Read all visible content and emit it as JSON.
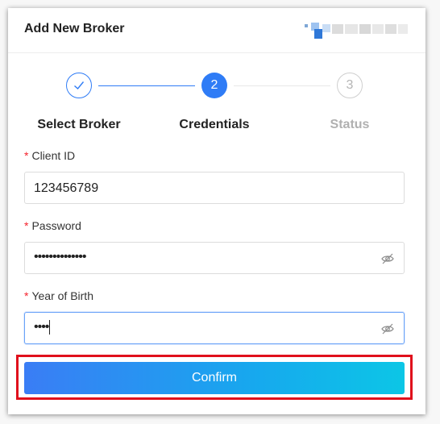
{
  "dialog": {
    "title": "Add New Broker"
  },
  "steps": [
    {
      "number": "1",
      "label": "Select Broker",
      "state": "done"
    },
    {
      "number": "2",
      "label": "Credentials",
      "state": "active"
    },
    {
      "number": "3",
      "label": "Status",
      "state": "pending"
    }
  ],
  "form": {
    "required_mark": "*",
    "client_id": {
      "label": "Client ID",
      "value": "123456789"
    },
    "password": {
      "label": "Password",
      "value": "••••••••••••••"
    },
    "year_of_birth": {
      "label": "Year of Birth",
      "value": "••••"
    }
  },
  "confirm_label": "Confirm",
  "colors": {
    "accent": "#2f7cf6",
    "required": "#f5222d",
    "highlight": "#e0101c"
  }
}
